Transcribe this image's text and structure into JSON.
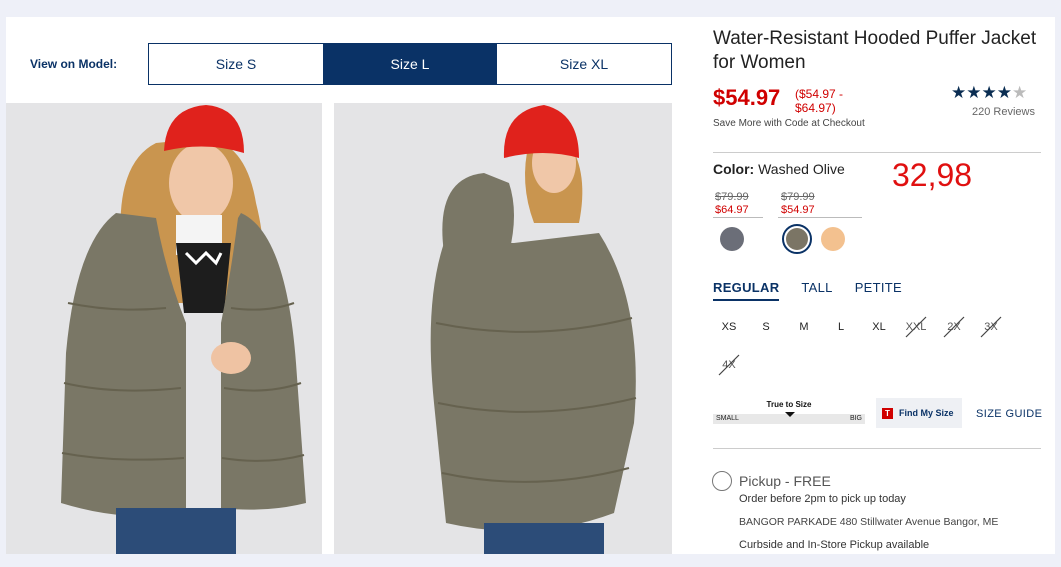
{
  "model_view": {
    "label": "View on Model:",
    "sizes": [
      "Size S",
      "Size L",
      "Size XL"
    ],
    "active": "Size L"
  },
  "product": {
    "title": "Water-Resistant Hooded Puffer Jacket for Women",
    "price": "$54.97",
    "price_range": "($54.97 - $64.97)",
    "save_more": "Save More with Code at Checkout",
    "rating": 4.5,
    "reviews": "220 Reviews"
  },
  "color": {
    "label": "Color:",
    "value": "Washed Olive",
    "swatch_prices": [
      {
        "old": "$79.99",
        "new": "$64.97"
      },
      {
        "old": "$79.99",
        "new": "$54.97"
      }
    ],
    "swatches": [
      {
        "name": "slate-gray",
        "hex": "#6b6e78",
        "selected": false
      },
      {
        "name": "washed-olive",
        "hex": "#7b7565",
        "selected": true
      },
      {
        "name": "peach",
        "hex": "#f3c18f",
        "selected": false
      }
    ]
  },
  "annotation": "32,98",
  "fit": {
    "tabs": [
      "REGULAR",
      "TALL",
      "PETITE"
    ],
    "active": "REGULAR",
    "sizes": [
      {
        "label": "XS",
        "available": true
      },
      {
        "label": "S",
        "available": true
      },
      {
        "label": "M",
        "available": true
      },
      {
        "label": "L",
        "available": true
      },
      {
        "label": "XL",
        "available": true
      },
      {
        "label": "XXL",
        "available": false
      },
      {
        "label": "2X",
        "available": false
      },
      {
        "label": "3X",
        "available": false
      },
      {
        "label": "4X",
        "available": false
      }
    ]
  },
  "fit_meter": {
    "center": "True to Size",
    "small": "SMALL",
    "big": "BIG",
    "find_label": "Find My Size",
    "size_guide": "SIZE GUIDE"
  },
  "pickup": {
    "label": "Pickup - FREE",
    "order_before": "Order before 2pm to pick up today",
    "store": "BANGOR PARKADE 480 Stillwater Avenue  Bangor, ME",
    "options": "Curbside and In-Store Pickup available"
  },
  "colors": {
    "navy": "#0a3266",
    "sale_red": "#d00000",
    "annotation_red": "#e01010"
  }
}
